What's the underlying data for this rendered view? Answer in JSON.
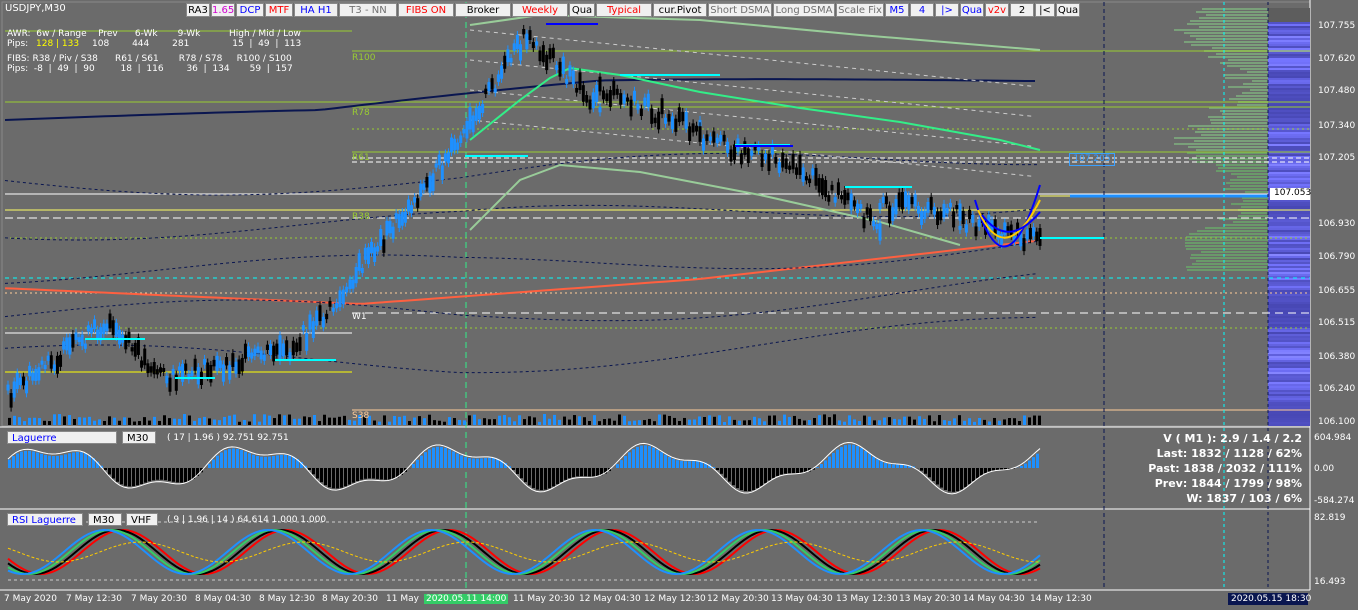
{
  "symbol": "USDJPY,M30",
  "toolbar": [
    {
      "label": "RA3",
      "color": "#000000"
    },
    {
      "label": "1.65",
      "color": "#d000d0"
    },
    {
      "label": "DCP",
      "color": "#0000ff"
    },
    {
      "label": "MTF",
      "color": "#ff0000"
    },
    {
      "label": "HA H1",
      "color": "#0000ff"
    },
    {
      "label": "T3 - NN",
      "color": "#707070"
    },
    {
      "label": "FIBS ON",
      "color": "#ff0000"
    },
    {
      "label": "Broker",
      "color": "#000000"
    },
    {
      "label": "Weekly",
      "color": "#ff0000"
    },
    {
      "label": "Qua",
      "color": "#000000"
    },
    {
      "label": "Typical",
      "color": "#ff0000"
    },
    {
      "label": "cur.Pivot",
      "color": "#000000"
    },
    {
      "label": "Short DSMA",
      "color": "#707070"
    },
    {
      "label": "Long DSMA",
      "color": "#707070"
    },
    {
      "label": "Scale Fix",
      "color": "#707070"
    },
    {
      "label": "M5",
      "color": "#0000ff"
    },
    {
      "label": "4",
      "color": "#0000ff"
    },
    {
      "label": "|>",
      "color": "#0000ff"
    },
    {
      "label": "Qua",
      "color": "#0000ff"
    },
    {
      "label": "v2v",
      "color": "#ff0000"
    },
    {
      "label": "2",
      "color": "#000000"
    },
    {
      "label": "|<",
      "color": "#000000"
    },
    {
      "label": "Qua",
      "color": "#000000"
    }
  ],
  "stats": {
    "awr_line": "AWR:  6w / Range    Prev      6-Wk       9-Wk          High / Mid / Low",
    "pips_label": "Pips:",
    "pips_awr": "128 | 133",
    "pips_rest": "108        444        281               15  |  49  |  113",
    "fibs_line": "FIBS: R38 / Piv / S38      R61 / S61       R78 / S78     R100 / S100",
    "fibs_pips": "Pips:  -8  |  49  |  90         18  |  116        36  |  134       59  |  157"
  },
  "fib_labels": [
    "R100",
    "R78",
    "R61",
    "R38",
    "W1",
    "S38"
  ],
  "price_axis": [
    "107.755",
    "107.620",
    "107.480",
    "107.340",
    "107.205",
    "107.053",
    "106.930",
    "106.790",
    "106.655",
    "106.515",
    "106.380",
    "106.240",
    "106.100"
  ],
  "current_price": "107.053",
  "price_tag": "107.205",
  "time_axis": [
    "7 May 2020",
    "7 May 12:30",
    "7 May 20:30",
    "8 May 04:30",
    "8 May 12:30",
    "8 May 20:30",
    "11 May",
    "2020.05.11 14:00",
    "11 May 20:30",
    "12 May 04:30",
    "12 May 12:30",
    "12 May 20:30",
    "13 May 04:30",
    "13 May 12:30",
    "13 May 20:30",
    "14 May 04:30",
    "14 May 12:30"
  ],
  "time_tag_right": "2020.05.15 18:30",
  "laguerre": {
    "name": "Laguerre",
    "tf": "M30",
    "params": "( 17 | 1.96 ) 92.751 92.751",
    "axis_top": "604.984",
    "axis_mid": "0.00",
    "axis_bot": "-584.274",
    "volume_lines": [
      "V ( M1 ): 2.9 / 1.4 / 2.2",
      "Last: 1832 / 1128 / 62%",
      "Past: 1838 / 2032 / 111%",
      "Prev: 1844 / 1799 / 98%",
      "W: 1837 / 103 / 6%"
    ]
  },
  "rsi": {
    "name": "RSI Laguerre",
    "tf": "M30",
    "extra": "VHF",
    "params": "( 9 | 1.96 | 14 ) 64.614 1.000 1.000",
    "axis_top": "82.819",
    "axis_bot": "16.493"
  },
  "colors": {
    "bg": "#6b6b6b",
    "bull": "#1e90ff",
    "bear": "#000000",
    "ema_green": "#33ee88",
    "ema_navy": "#0a1650",
    "ma_red": "#ff6040",
    "fib_green": "#9acd32",
    "cyan": "#00ffff"
  }
}
